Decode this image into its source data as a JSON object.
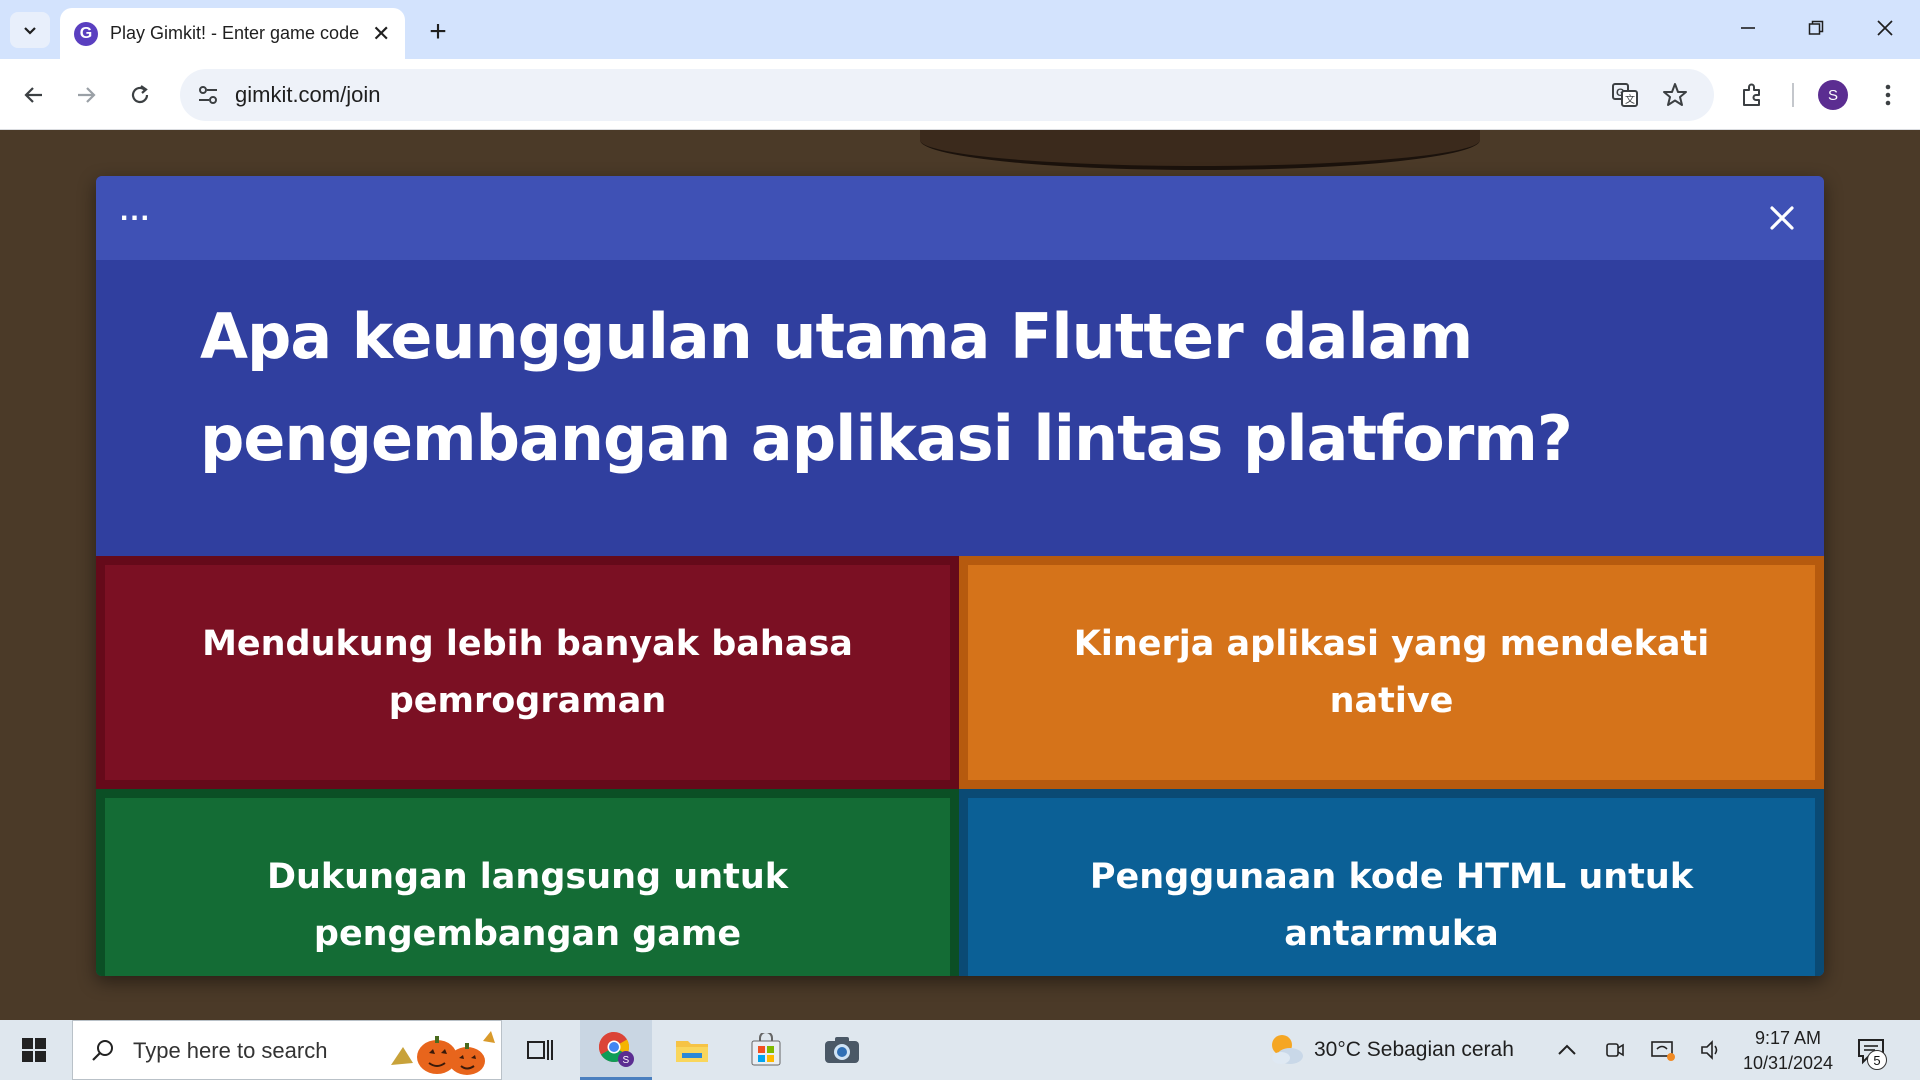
{
  "browser": {
    "tab_title": "Play Gimkit! - Enter game code",
    "favicon_letter": "G",
    "url": "gimkit.com/join",
    "profile_initial": "S"
  },
  "modal": {
    "menu_dots": "...",
    "question": "Apa keunggulan utama Flutter dalam pengembangan aplikasi lintas platform?",
    "answers": [
      {
        "text": "Mendukung lebih banyak bahasa pemrograman",
        "color": "#7b1023"
      },
      {
        "text": "Kinerja aplikasi yang mendekati native",
        "color": "#d5731a"
      },
      {
        "text": "Dukungan langsung untuk pengembangan game",
        "color": "#146c35"
      },
      {
        "text": "Penggunaan kode HTML untuk antarmuka",
        "color": "#0b6096"
      }
    ]
  },
  "taskbar": {
    "search_placeholder": "Type here to search",
    "weather": "30°C  Sebagian cerah",
    "time": "9:17 AM",
    "date": "10/31/2024",
    "notification_count": "5",
    "chrome_badge": "S"
  },
  "icons": [
    "tab-list-icon",
    "close-tab-icon",
    "new-tab-icon",
    "minimize-icon",
    "restore-icon",
    "close-window-icon",
    "back-icon",
    "forward-icon",
    "reload-icon",
    "site-info-icon",
    "translate-icon",
    "star-icon",
    "extensions-icon",
    "menu-icon",
    "modal-close-icon",
    "windows-start-icon",
    "search-icon",
    "task-view-icon",
    "chrome-icon",
    "file-explorer-icon",
    "store-icon",
    "camera-icon",
    "weather-icon",
    "chevron-up-icon",
    "meet-icon",
    "network-icon",
    "volume-icon",
    "notification-icon"
  ]
}
